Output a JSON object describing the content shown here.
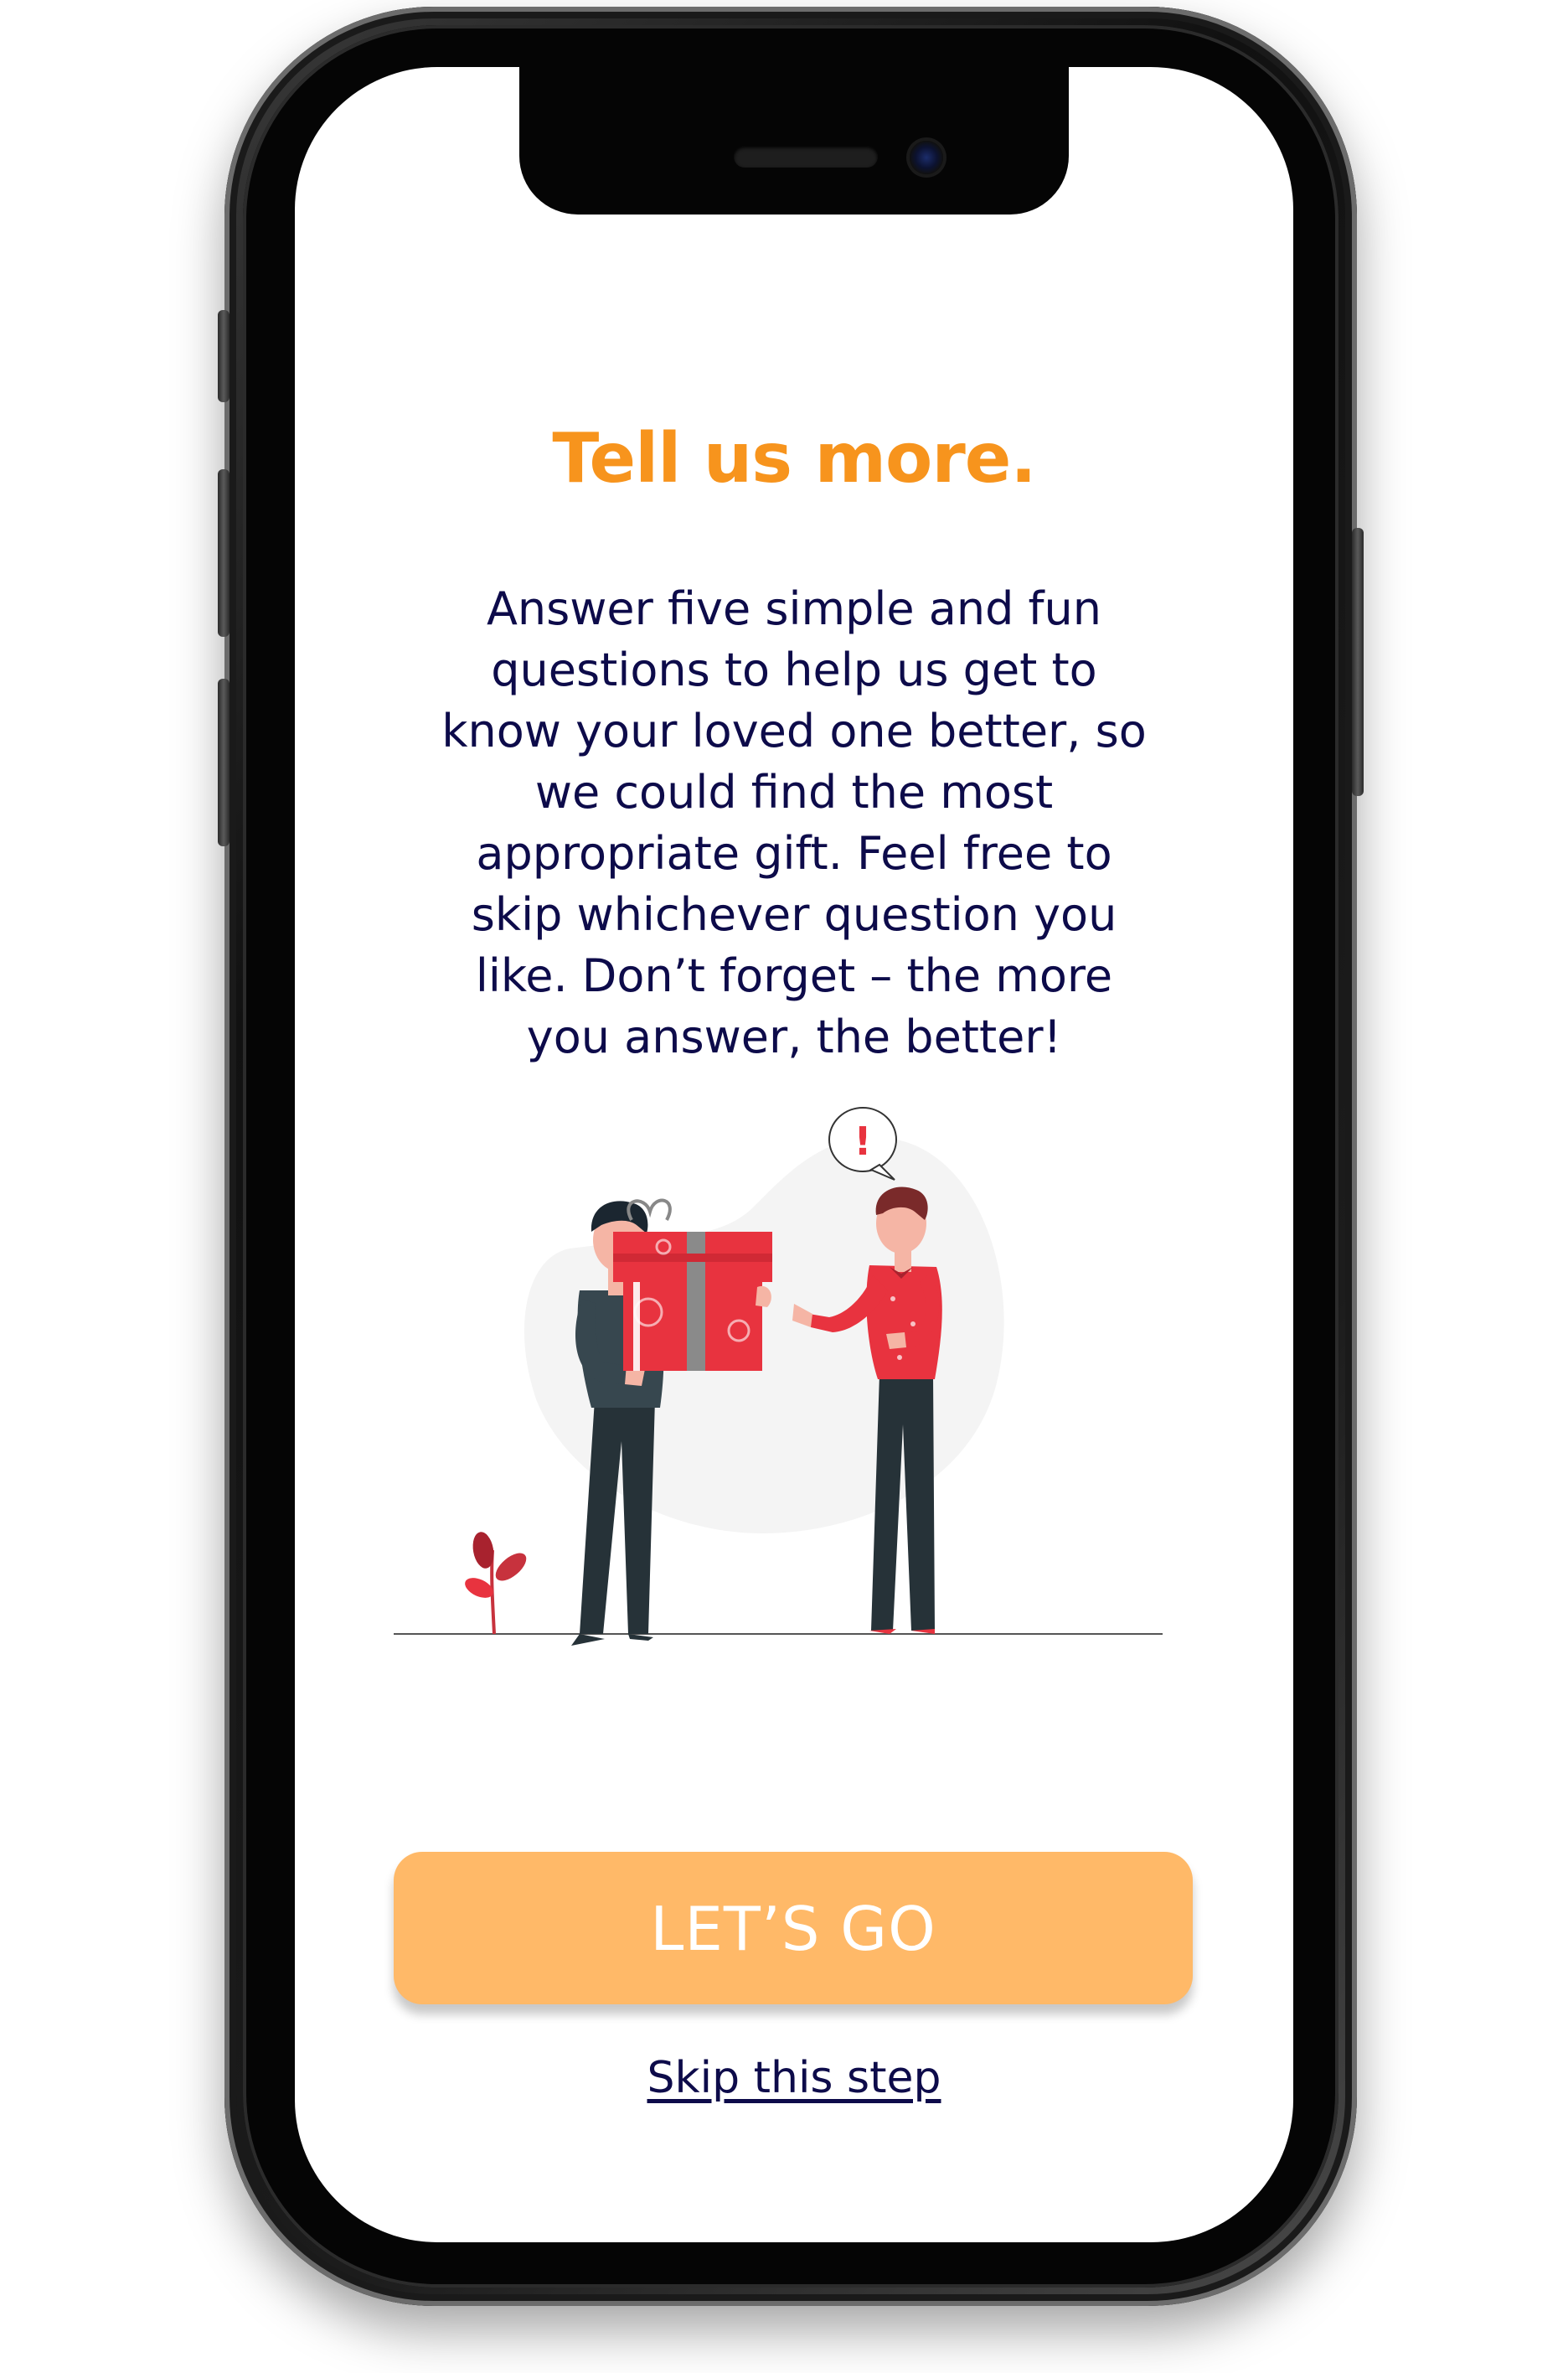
{
  "screen": {
    "title": "Tell us more.",
    "description": "Answer five simple and fun questions to help us get to know your loved one better, so we could find the most appropriate gift. Feel free to skip whichever question you like. Don’t forget – the more you answer, the better!",
    "primary_button_label": "LET’S GO",
    "skip_link_label": "Skip this step"
  },
  "illustration": {
    "speech_bubble_text": "!",
    "icon": "gift-exchange-illustration"
  },
  "colors": {
    "title": "#f7941d",
    "text": "#0d0b4a",
    "button": "#ffb968",
    "gift_red": "#e8333f",
    "shirt_dark": "#37474f",
    "pants": "#263238"
  }
}
